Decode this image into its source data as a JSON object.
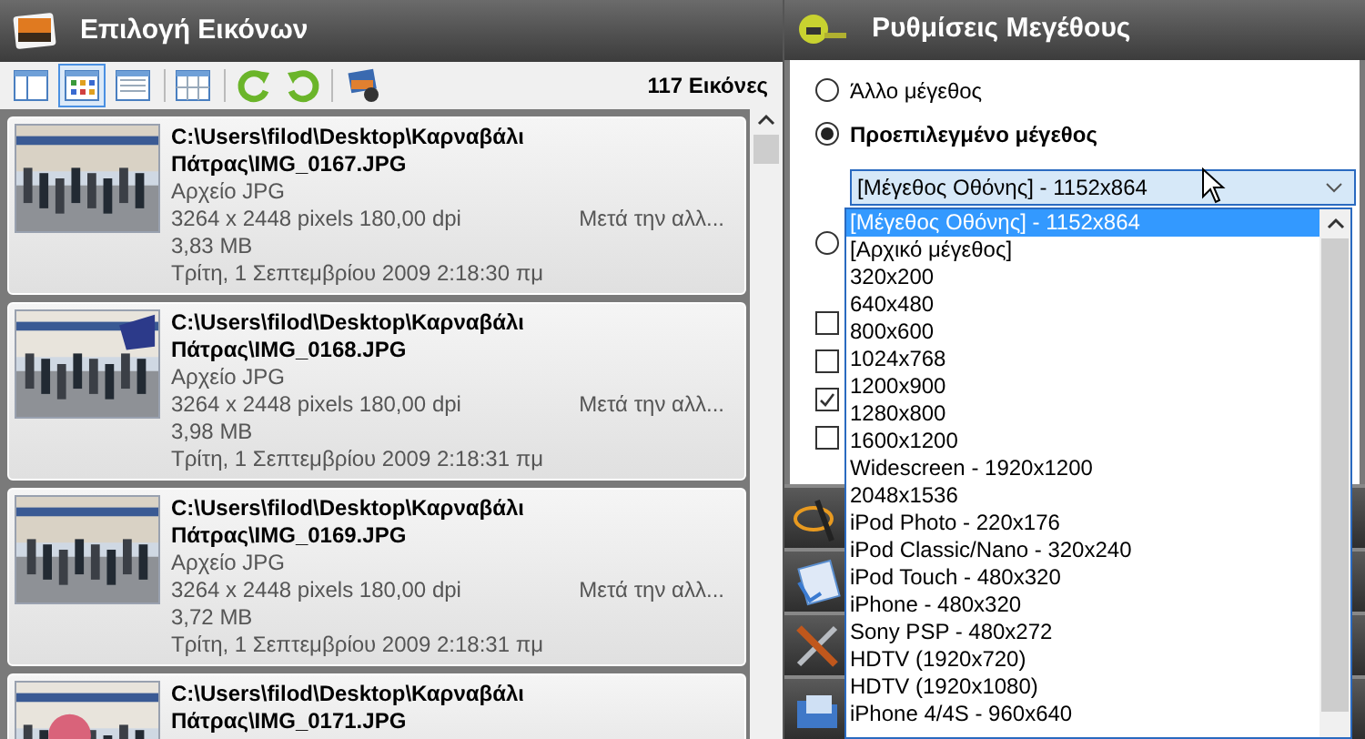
{
  "left_panel": {
    "title": "Επιλογή Εικόνων",
    "toolbar": {
      "view_buttons": [
        {
          "kind": "panes",
          "selected": false
        },
        {
          "kind": "thumbnails",
          "selected": true
        },
        {
          "kind": "details",
          "selected": false
        },
        {
          "kind": "table",
          "selected": false
        }
      ],
      "count": "117 Εικόνες"
    },
    "images": [
      {
        "path": "C:\\Users\\filod\\Desktop\\Καρναβάλι Πάτρας\\IMG_0167.JPG",
        "type": "Αρχείο JPG",
        "dimensions": "3264 x 2448 pixels 180,00 dpi",
        "note": "Μετά την αλλ...",
        "size": "3,83 MB",
        "date": "Τρίτη, 1 Σεπτεμβρίου 2009 2:18:30 πμ"
      },
      {
        "path": "C:\\Users\\filod\\Desktop\\Καρναβάλι Πάτρας\\IMG_0168.JPG",
        "type": "Αρχείο JPG",
        "dimensions": "3264 x 2448 pixels 180,00 dpi",
        "note": "Μετά την αλλ...",
        "size": "3,98 MB",
        "date": "Τρίτη, 1 Σεπτεμβρίου 2009 2:18:31 πμ"
      },
      {
        "path": "C:\\Users\\filod\\Desktop\\Καρναβάλι Πάτρας\\IMG_0169.JPG",
        "type": "Αρχείο JPG",
        "dimensions": "3264 x 2448 pixels 180,00 dpi",
        "note": "Μετά την αλλ...",
        "size": "3,72 MB",
        "date": "Τρίτη, 1 Σεπτεμβρίου 2009 2:18:31 πμ"
      },
      {
        "path": "C:\\Users\\filod\\Desktop\\Καρναβάλι Πάτρας\\IMG_0171.JPG"
      }
    ]
  },
  "right_panel": {
    "title": "Ρυθμίσεις Μεγέθους",
    "radios": [
      {
        "label": "Άλλο μέγεθος",
        "selected": false
      },
      {
        "label": "Προεπιλεγμένο μέγεθος",
        "selected": true
      }
    ],
    "size_select": {
      "value": "[Μέγεθος Οθόνης] - 1152x864"
    },
    "options": [
      {
        "label": "[Μέγεθος Οθόνης] - 1152x864",
        "selected": true
      },
      {
        "label": "[Αρχικό μέγεθος]",
        "selected": false
      },
      {
        "label": "320x200",
        "selected": false
      },
      {
        "label": "640x480",
        "selected": false
      },
      {
        "label": "800x600",
        "selected": false
      },
      {
        "label": "1024x768",
        "selected": false
      },
      {
        "label": "1200x900",
        "selected": false
      },
      {
        "label": "1280x800",
        "selected": false
      },
      {
        "label": "1600x1200",
        "selected": false
      },
      {
        "label": "Widescreen - 1920x1200",
        "selected": false
      },
      {
        "label": "2048x1536",
        "selected": false
      },
      {
        "label": "iPod Photo - 220x176",
        "selected": false
      },
      {
        "label": "iPod Classic/Nano - 320x240",
        "selected": false
      },
      {
        "label": "iPod Touch - 480x320",
        "selected": false
      },
      {
        "label": "iPhone - 480x320",
        "selected": false
      },
      {
        "label": "Sony PSP - 480x272",
        "selected": false
      },
      {
        "label": "HDTV (1920x720)",
        "selected": false
      },
      {
        "label": "HDTV (1920x1080)",
        "selected": false
      },
      {
        "label": "iPhone 4/4S - 960x640",
        "selected": false
      }
    ],
    "checkboxes": [
      {
        "checked": false
      },
      {
        "checked": false
      },
      {
        "checked": true
      },
      {
        "checked": false
      }
    ],
    "side_buttons": [
      {
        "kind": "wand"
      },
      {
        "kind": "page"
      },
      {
        "kind": "tools"
      },
      {
        "kind": "folder"
      }
    ]
  }
}
